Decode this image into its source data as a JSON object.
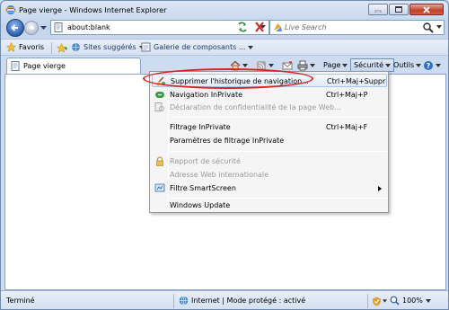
{
  "window": {
    "title": "Page vierge - Windows Internet Explorer"
  },
  "address": {
    "url": "about:blank"
  },
  "search": {
    "placeholder": "Live Search"
  },
  "favorites_bar": {
    "favoris_label": "Favoris",
    "items": [
      {
        "label": "Sites suggérés"
      },
      {
        "label": "Galerie de composants ..."
      }
    ]
  },
  "tab": {
    "label": "Page vierge"
  },
  "commandbar": {
    "page_label": "Page",
    "securite_label": "Sécurité",
    "outils_label": "Outils"
  },
  "menu": {
    "items": [
      {
        "label": "Supprimer l'historique de navigation...",
        "shortcut": "Ctrl+Maj+Suppr",
        "icon": "broom-icon",
        "disabled": false
      },
      {
        "label": "Navigation InPrivate",
        "shortcut": "Ctrl+Maj+P",
        "icon": "inprivate-icon",
        "disabled": false
      },
      {
        "label": "Déclaration de confidentialité de la page Web...",
        "shortcut": "",
        "icon": "privacy-icon",
        "disabled": true
      },
      {
        "label": "Filtrage InPrivate",
        "shortcut": "Ctrl+Maj+F",
        "icon": "",
        "disabled": false
      },
      {
        "label": "Paramètres de filtrage InPrivate",
        "shortcut": "",
        "icon": "",
        "disabled": false
      },
      {
        "label": "Rapport de sécurité",
        "shortcut": "",
        "icon": "lock-icon",
        "disabled": true
      },
      {
        "label": "Adresse Web internationale",
        "shortcut": "",
        "icon": "",
        "disabled": true
      },
      {
        "label": "Filtre SmartScreen",
        "shortcut": "",
        "icon": "smartscreen-icon",
        "disabled": false
      },
      {
        "label": "Windows Update",
        "shortcut": "",
        "icon": "",
        "disabled": false
      }
    ]
  },
  "statusbar": {
    "status": "Terminé",
    "zone": "Internet | Mode protégé : activé",
    "zoom": "100%"
  },
  "colors": {
    "highlight_ellipse": "#dd2020",
    "accent": "#2c5fb0"
  }
}
